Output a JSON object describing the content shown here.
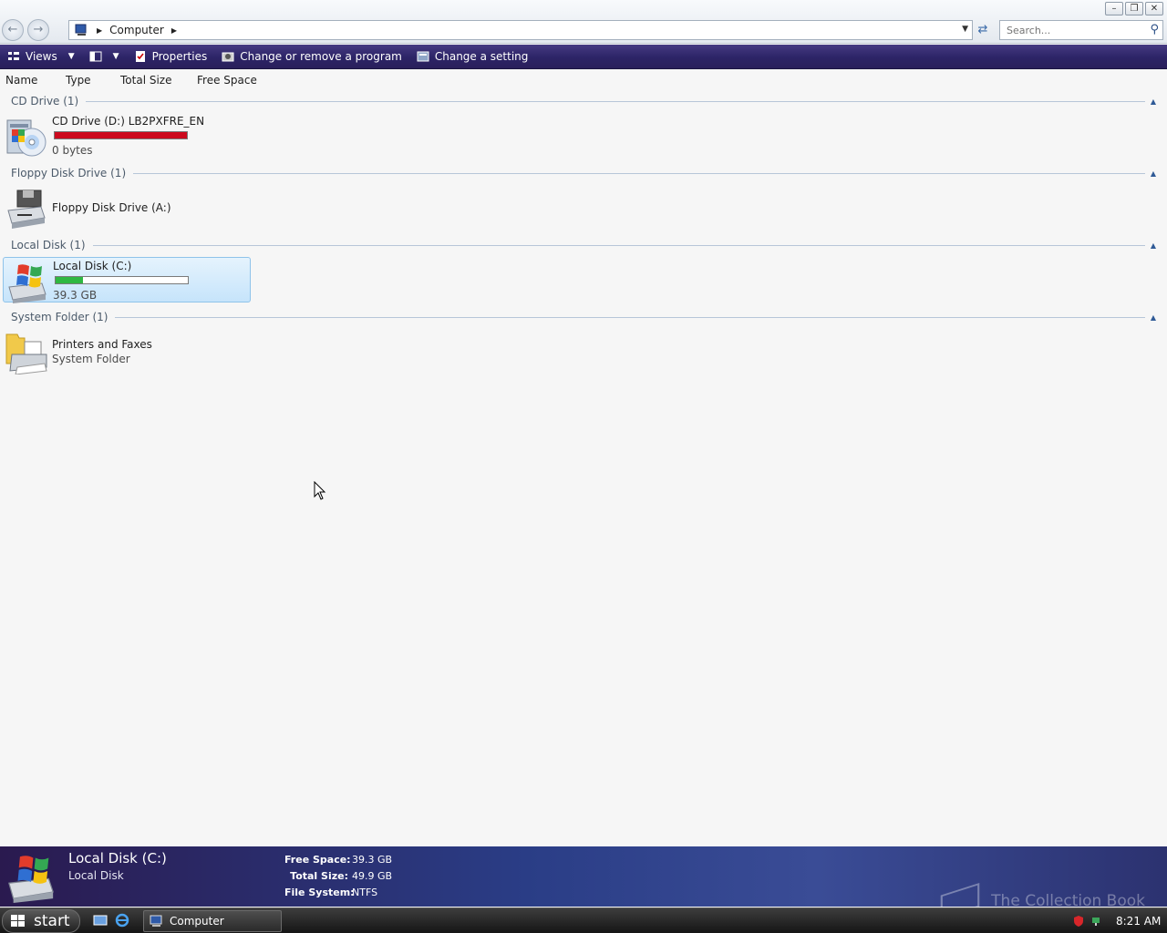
{
  "window": {
    "breadcrumb": [
      "Computer"
    ],
    "search_placeholder": "Search..."
  },
  "commandbar": {
    "views": "Views",
    "properties": "Properties",
    "change_program": "Change or remove a program",
    "change_setting": "Change a setting"
  },
  "columns": [
    "Name",
    "Type",
    "Total Size",
    "Free Space"
  ],
  "groups": [
    {
      "title": "CD Drive (1)",
      "item": {
        "name": "CD Drive (D:) LB2PXFRE_EN",
        "sub": "0 bytes",
        "usage_fraction": 1.0,
        "bar_color": "#cc0a1e"
      }
    },
    {
      "title": "Floppy Disk Drive (1)",
      "item": {
        "name": "Floppy Disk Drive (A:)"
      }
    },
    {
      "title": "Local Disk (1)",
      "item": {
        "name": "Local Disk (C:)",
        "sub": "39.3 GB",
        "usage_fraction": 0.21,
        "bar_color": "#2fb842",
        "selected": true
      }
    },
    {
      "title": "System Folder (1)",
      "item": {
        "name": "Printers and Faxes",
        "sub": "System Folder"
      }
    }
  ],
  "details": {
    "name": "Local Disk (C:)",
    "type": "Local Disk",
    "props": [
      {
        "k": "Free Space:",
        "v": "39.3 GB"
      },
      {
        "k": "Total Size:",
        "v": "49.9 GB"
      },
      {
        "k": "File System:",
        "v": "NTFS"
      }
    ],
    "watermark": "The Collection Book"
  },
  "taskbar": {
    "start": "start",
    "task": "Computer",
    "clock": "8:21 AM"
  },
  "colors": {
    "accent": "#2c2466",
    "selection": "#c6e4fb"
  }
}
